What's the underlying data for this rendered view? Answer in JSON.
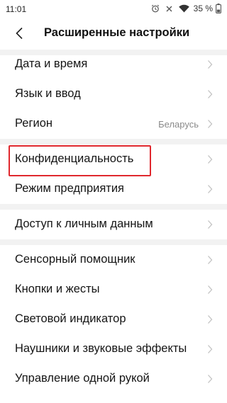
{
  "status_bar": {
    "time": "11:01",
    "icons": [
      "alarm-icon",
      "no-sim-icon",
      "wifi-icon",
      "battery-icon"
    ],
    "battery": "35 %"
  },
  "header": {
    "title": "Расширенные настройки",
    "back_icon": "back-arrow-icon"
  },
  "groups": [
    {
      "items": [
        {
          "label": "Дата и время"
        },
        {
          "label": "Язык и ввод"
        },
        {
          "label": "Регион",
          "value": "Беларусь"
        }
      ]
    },
    {
      "items": [
        {
          "label": "Конфиденциальность",
          "highlighted": true
        },
        {
          "label": "Режим предприятия"
        }
      ]
    },
    {
      "items": [
        {
          "label": "Доступ к личным данным"
        }
      ]
    },
    {
      "items": [
        {
          "label": "Сенсорный помощник"
        },
        {
          "label": "Кнопки и жесты"
        },
        {
          "label": "Световой индикатор"
        },
        {
          "label": "Наушники и звуковые эффекты"
        },
        {
          "label": "Управление одной рукой"
        }
      ]
    }
  ],
  "colors": {
    "highlight": "#e0282e",
    "divider": "#f2f2f2",
    "chevron": "#c2c2c2",
    "value": "#8a8a8a"
  }
}
